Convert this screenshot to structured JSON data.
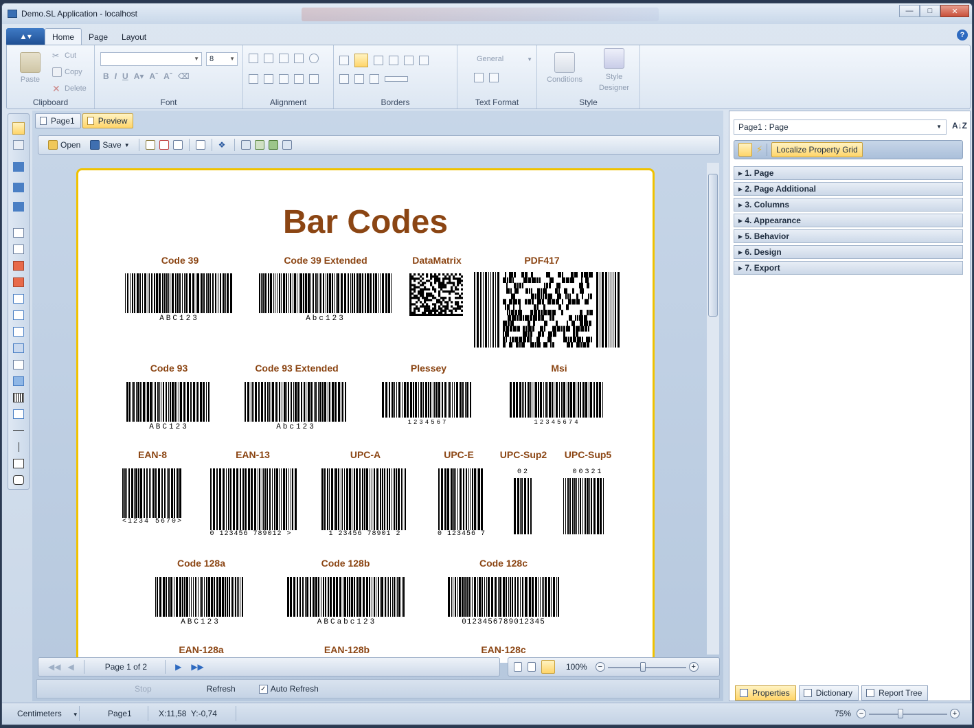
{
  "window": {
    "title": "Demo.SL Application - localhost"
  },
  "ribbon": {
    "tabs": [
      "Home",
      "Page",
      "Layout"
    ],
    "clipboard": {
      "paste": "Paste",
      "cut": "Cut",
      "copy": "Copy",
      "delete": "Delete",
      "label": "Clipboard"
    },
    "font": {
      "size": "8",
      "label": "Font"
    },
    "alignment": {
      "label": "Alignment"
    },
    "borders": {
      "label": "Borders"
    },
    "text_format": {
      "combo": "General",
      "label": "Text Format"
    },
    "style": {
      "conditions": "Conditions",
      "designer_line1": "Style",
      "designer_line2": "Designer",
      "label": "Style"
    }
  },
  "designer": {
    "tabs": {
      "page": "Page1",
      "preview": "Preview"
    },
    "toolbar": {
      "open": "Open",
      "save": "Save"
    },
    "report": {
      "title": "Bar Codes",
      "barcodes": {
        "code39": {
          "label": "Code 39",
          "text": "ABC123"
        },
        "code39ext": {
          "label": "Code 39 Extended",
          "text": "Abc123"
        },
        "datamatrix": {
          "label": "DataMatrix"
        },
        "pdf417": {
          "label": "PDF417"
        },
        "code93": {
          "label": "Code 93",
          "text": "ABC123"
        },
        "code93ext": {
          "label": "Code 93 Extended",
          "text": "Abc123"
        },
        "plessey": {
          "label": "Plessey",
          "text": "1234567"
        },
        "msi": {
          "label": "Msi",
          "text": "12345674"
        },
        "ean8": {
          "label": "EAN-8",
          "text": "<1234 5670>"
        },
        "ean13": {
          "label": "EAN-13",
          "text": "0 123456 789012 >"
        },
        "upca": {
          "label": "UPC-A",
          "text": "1 23456 78901 2"
        },
        "upce": {
          "label": "UPC-E",
          "text": "0 123456 7"
        },
        "upcsup2": {
          "label": "UPC-Sup2",
          "text": "02"
        },
        "upcsup5": {
          "label": "UPC-Sup5",
          "text": "00321"
        },
        "code128a": {
          "label": "Code 128a",
          "text": "ABC123"
        },
        "code128b": {
          "label": "Code 128b",
          "text": "ABCabc123"
        },
        "code128c": {
          "label": "Code 128c",
          "text": "0123456789012345"
        },
        "ean128a": {
          "label": "EAN-128a"
        },
        "ean128b": {
          "label": "EAN-128b"
        },
        "ean128c": {
          "label": "EAN-128c"
        }
      }
    },
    "nav": {
      "page_status": "Page 1 of 2"
    },
    "zoom": {
      "value": "100%",
      "fraction": 0.45
    },
    "refresh": {
      "stop": "Stop",
      "refresh": "Refresh",
      "auto_refresh": "Auto Refresh",
      "auto_refresh_checked": true
    }
  },
  "properties": {
    "selected_object": "Page1 : Page",
    "localize": "Localize Property Grid",
    "categories": [
      "1. Page",
      "2. Page Additional",
      "3. Columns",
      "4. Appearance",
      "5. Behavior",
      "6. Design",
      "7. Export"
    ],
    "tabs": {
      "properties": "Properties",
      "dictionary": "Dictionary",
      "report_tree": "Report Tree"
    }
  },
  "status": {
    "units": "Centimeters",
    "page": "Page1",
    "coords": "X:11,58  Y:-0,74",
    "zoom": "75%",
    "zoom_fraction": 0.4
  },
  "colors": {
    "accent": "#f0c200",
    "brand": "#8b4513"
  }
}
